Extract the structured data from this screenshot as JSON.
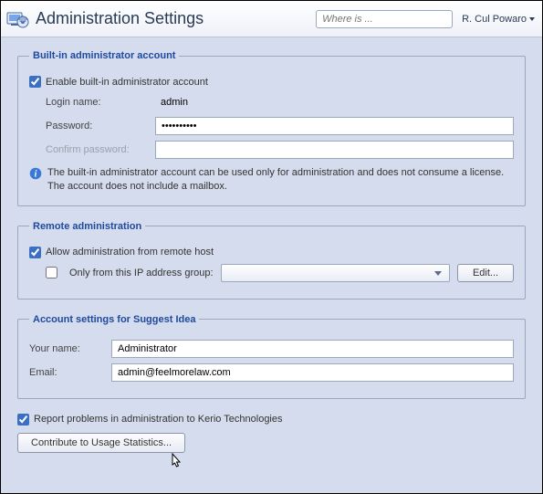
{
  "header": {
    "title": "Administration Settings",
    "search_placeholder": "Where is ...",
    "user": "R. Cul Powaro"
  },
  "group_admin": {
    "title": "Built-in administrator account",
    "enable_label": "Enable built-in administrator account",
    "enable_checked": true,
    "login_label": "Login name:",
    "login_value": "admin",
    "password_label": "Password:",
    "password_value": "••••••••••",
    "confirm_label": "Confirm password:",
    "confirm_value": "",
    "info": "The built-in administrator account can be used only for administration and does not consume a license. The account does not include a mailbox."
  },
  "group_remote": {
    "title": "Remote administration",
    "allow_label": "Allow administration from remote host",
    "allow_checked": true,
    "only_label": "Only from this IP address group:",
    "only_checked": false,
    "edit_label": "Edit..."
  },
  "group_suggest": {
    "title": "Account settings for Suggest Idea",
    "name_label": "Your name:",
    "name_value": "Administrator",
    "email_label": "Email:",
    "email_value": "admin@feelmorelaw.com"
  },
  "report_label": "Report problems in administration to Kerio Technologies",
  "report_checked": true,
  "contribute_label": "Contribute to Usage Statistics..."
}
